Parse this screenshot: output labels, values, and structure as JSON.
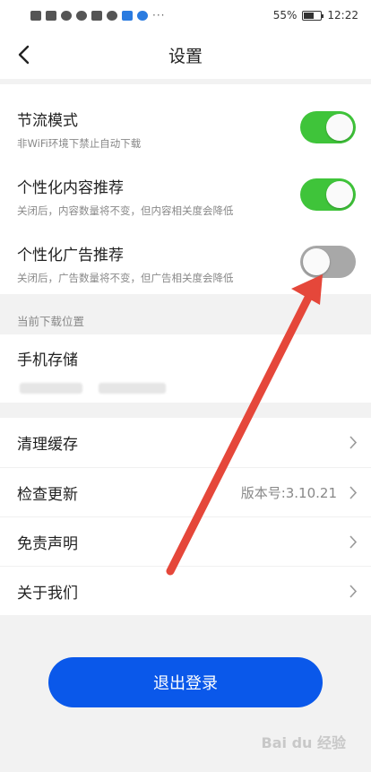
{
  "status_bar": {
    "battery": "55%",
    "time": "12:22",
    "dots": "···"
  },
  "header": {
    "title": "设置"
  },
  "settings": {
    "traffic_saving": {
      "title": "节流模式",
      "subtitle": "非WiFi环境下禁止自动下载",
      "enabled": true
    },
    "personal_content": {
      "title": "个性化内容推荐",
      "subtitle": "关闭后，内容数量将不变，但内容相关度会降低",
      "enabled": true
    },
    "personal_ads": {
      "title": "个性化广告推荐",
      "subtitle": "关闭后，广告数量将不变，但广告相关度会降低",
      "enabled": false
    }
  },
  "download": {
    "section_label": "当前下载位置",
    "location": "手机存储"
  },
  "menu": {
    "clear_cache": "清理缓存",
    "check_update": "检查更新",
    "version": "版本号:3.10.21",
    "disclaimer": "免责声明",
    "about": "关于我们"
  },
  "logout_label": "退出登录",
  "watermark": "Bai du 经验",
  "colors": {
    "toggle_on": "#3fc43a",
    "toggle_off": "#a8a8a8",
    "primary_button": "#0a58ea",
    "annotation_arrow": "#e5473a"
  }
}
